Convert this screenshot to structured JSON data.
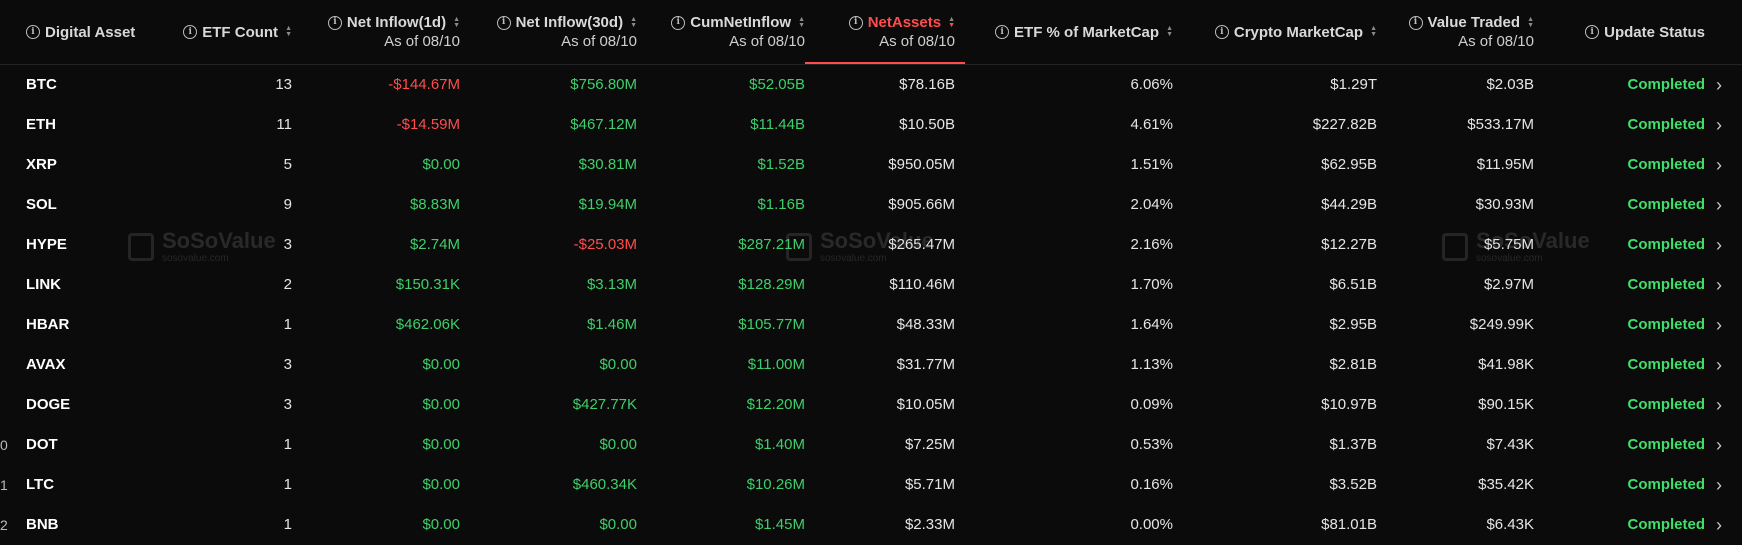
{
  "columns": [
    {
      "key": "asset",
      "label": "Digital Asset",
      "sub": ""
    },
    {
      "key": "etf_count",
      "label": "ETF Count",
      "sub": ""
    },
    {
      "key": "inflow_1d",
      "label": "Net Inflow(1d)",
      "sub": "As of 08/10"
    },
    {
      "key": "inflow_30d",
      "label": "Net Inflow(30d)",
      "sub": "As of 08/10"
    },
    {
      "key": "cum_inflow",
      "label": "CumNetInflow",
      "sub": "As of 08/10"
    },
    {
      "key": "net_assets",
      "label": "NetAssets",
      "sub": "As of 08/10"
    },
    {
      "key": "etf_pct",
      "label": "ETF % of MarketCap",
      "sub": ""
    },
    {
      "key": "market_cap",
      "label": "Crypto MarketCap",
      "sub": ""
    },
    {
      "key": "value_traded",
      "label": "Value Traded",
      "sub": "As of 08/10"
    },
    {
      "key": "status",
      "label": "Update Status",
      "sub": ""
    }
  ],
  "sorted_column": "net_assets",
  "rows": [
    {
      "idx": "",
      "asset": "BTC",
      "etf_count": "13",
      "inflow_1d": "-$144.67M",
      "inflow_30d": "$756.80M",
      "cum_inflow": "$52.05B",
      "net_assets": "$78.16B",
      "etf_pct": "6.06%",
      "market_cap": "$1.29T",
      "value_traded": "$2.03B",
      "status": "Completed"
    },
    {
      "idx": "",
      "asset": "ETH",
      "etf_count": "11",
      "inflow_1d": "-$14.59M",
      "inflow_30d": "$467.12M",
      "cum_inflow": "$11.44B",
      "net_assets": "$10.50B",
      "etf_pct": "4.61%",
      "market_cap": "$227.82B",
      "value_traded": "$533.17M",
      "status": "Completed"
    },
    {
      "idx": "",
      "asset": "XRP",
      "etf_count": "5",
      "inflow_1d": "$0.00",
      "inflow_30d": "$30.81M",
      "cum_inflow": "$1.52B",
      "net_assets": "$950.05M",
      "etf_pct": "1.51%",
      "market_cap": "$62.95B",
      "value_traded": "$11.95M",
      "status": "Completed"
    },
    {
      "idx": "",
      "asset": "SOL",
      "etf_count": "9",
      "inflow_1d": "$8.83M",
      "inflow_30d": "$19.94M",
      "cum_inflow": "$1.16B",
      "net_assets": "$905.66M",
      "etf_pct": "2.04%",
      "market_cap": "$44.29B",
      "value_traded": "$30.93M",
      "status": "Completed"
    },
    {
      "idx": "",
      "asset": "HYPE",
      "etf_count": "3",
      "inflow_1d": "$2.74M",
      "inflow_30d": "-$25.03M",
      "cum_inflow": "$287.21M",
      "net_assets": "$265.47M",
      "etf_pct": "2.16%",
      "market_cap": "$12.27B",
      "value_traded": "$5.75M",
      "status": "Completed"
    },
    {
      "idx": "",
      "asset": "LINK",
      "etf_count": "2",
      "inflow_1d": "$150.31K",
      "inflow_30d": "$3.13M",
      "cum_inflow": "$128.29M",
      "net_assets": "$110.46M",
      "etf_pct": "1.70%",
      "market_cap": "$6.51B",
      "value_traded": "$2.97M",
      "status": "Completed"
    },
    {
      "idx": "",
      "asset": "HBAR",
      "etf_count": "1",
      "inflow_1d": "$462.06K",
      "inflow_30d": "$1.46M",
      "cum_inflow": "$105.77M",
      "net_assets": "$48.33M",
      "etf_pct": "1.64%",
      "market_cap": "$2.95B",
      "value_traded": "$249.99K",
      "status": "Completed"
    },
    {
      "idx": "",
      "asset": "AVAX",
      "etf_count": "3",
      "inflow_1d": "$0.00",
      "inflow_30d": "$0.00",
      "cum_inflow": "$11.00M",
      "net_assets": "$31.77M",
      "etf_pct": "1.13%",
      "market_cap": "$2.81B",
      "value_traded": "$41.98K",
      "status": "Completed"
    },
    {
      "idx": "",
      "asset": "DOGE",
      "etf_count": "3",
      "inflow_1d": "$0.00",
      "inflow_30d": "$427.77K",
      "cum_inflow": "$12.20M",
      "net_assets": "$10.05M",
      "etf_pct": "0.09%",
      "market_cap": "$10.97B",
      "value_traded": "$90.15K",
      "status": "Completed"
    },
    {
      "idx": "0",
      "asset": "DOT",
      "etf_count": "1",
      "inflow_1d": "$0.00",
      "inflow_30d": "$0.00",
      "cum_inflow": "$1.40M",
      "net_assets": "$7.25M",
      "etf_pct": "0.53%",
      "market_cap": "$1.37B",
      "value_traded": "$7.43K",
      "status": "Completed"
    },
    {
      "idx": "1",
      "asset": "LTC",
      "etf_count": "1",
      "inflow_1d": "$0.00",
      "inflow_30d": "$460.34K",
      "cum_inflow": "$10.26M",
      "net_assets": "$5.71M",
      "etf_pct": "0.16%",
      "market_cap": "$3.52B",
      "value_traded": "$35.42K",
      "status": "Completed"
    },
    {
      "idx": "2",
      "asset": "BNB",
      "etf_count": "1",
      "inflow_1d": "$0.00",
      "inflow_30d": "$0.00",
      "cum_inflow": "$1.45M",
      "net_assets": "$2.33M",
      "etf_pct": "0.00%",
      "market_cap": "$81.01B",
      "value_traded": "$6.43K",
      "status": "Completed"
    }
  ],
  "watermark": {
    "main": "SoSoValue",
    "sub": "sosovalue.com"
  },
  "icons": {
    "info": "info-icon",
    "sort": "sort-icon",
    "row_chevron": "chevron-right-icon"
  },
  "colors": {
    "positive": "#3fcf6a",
    "negative": "#ff4d4d",
    "accent": "#ff4d4d",
    "background": "#0b0b0b"
  }
}
